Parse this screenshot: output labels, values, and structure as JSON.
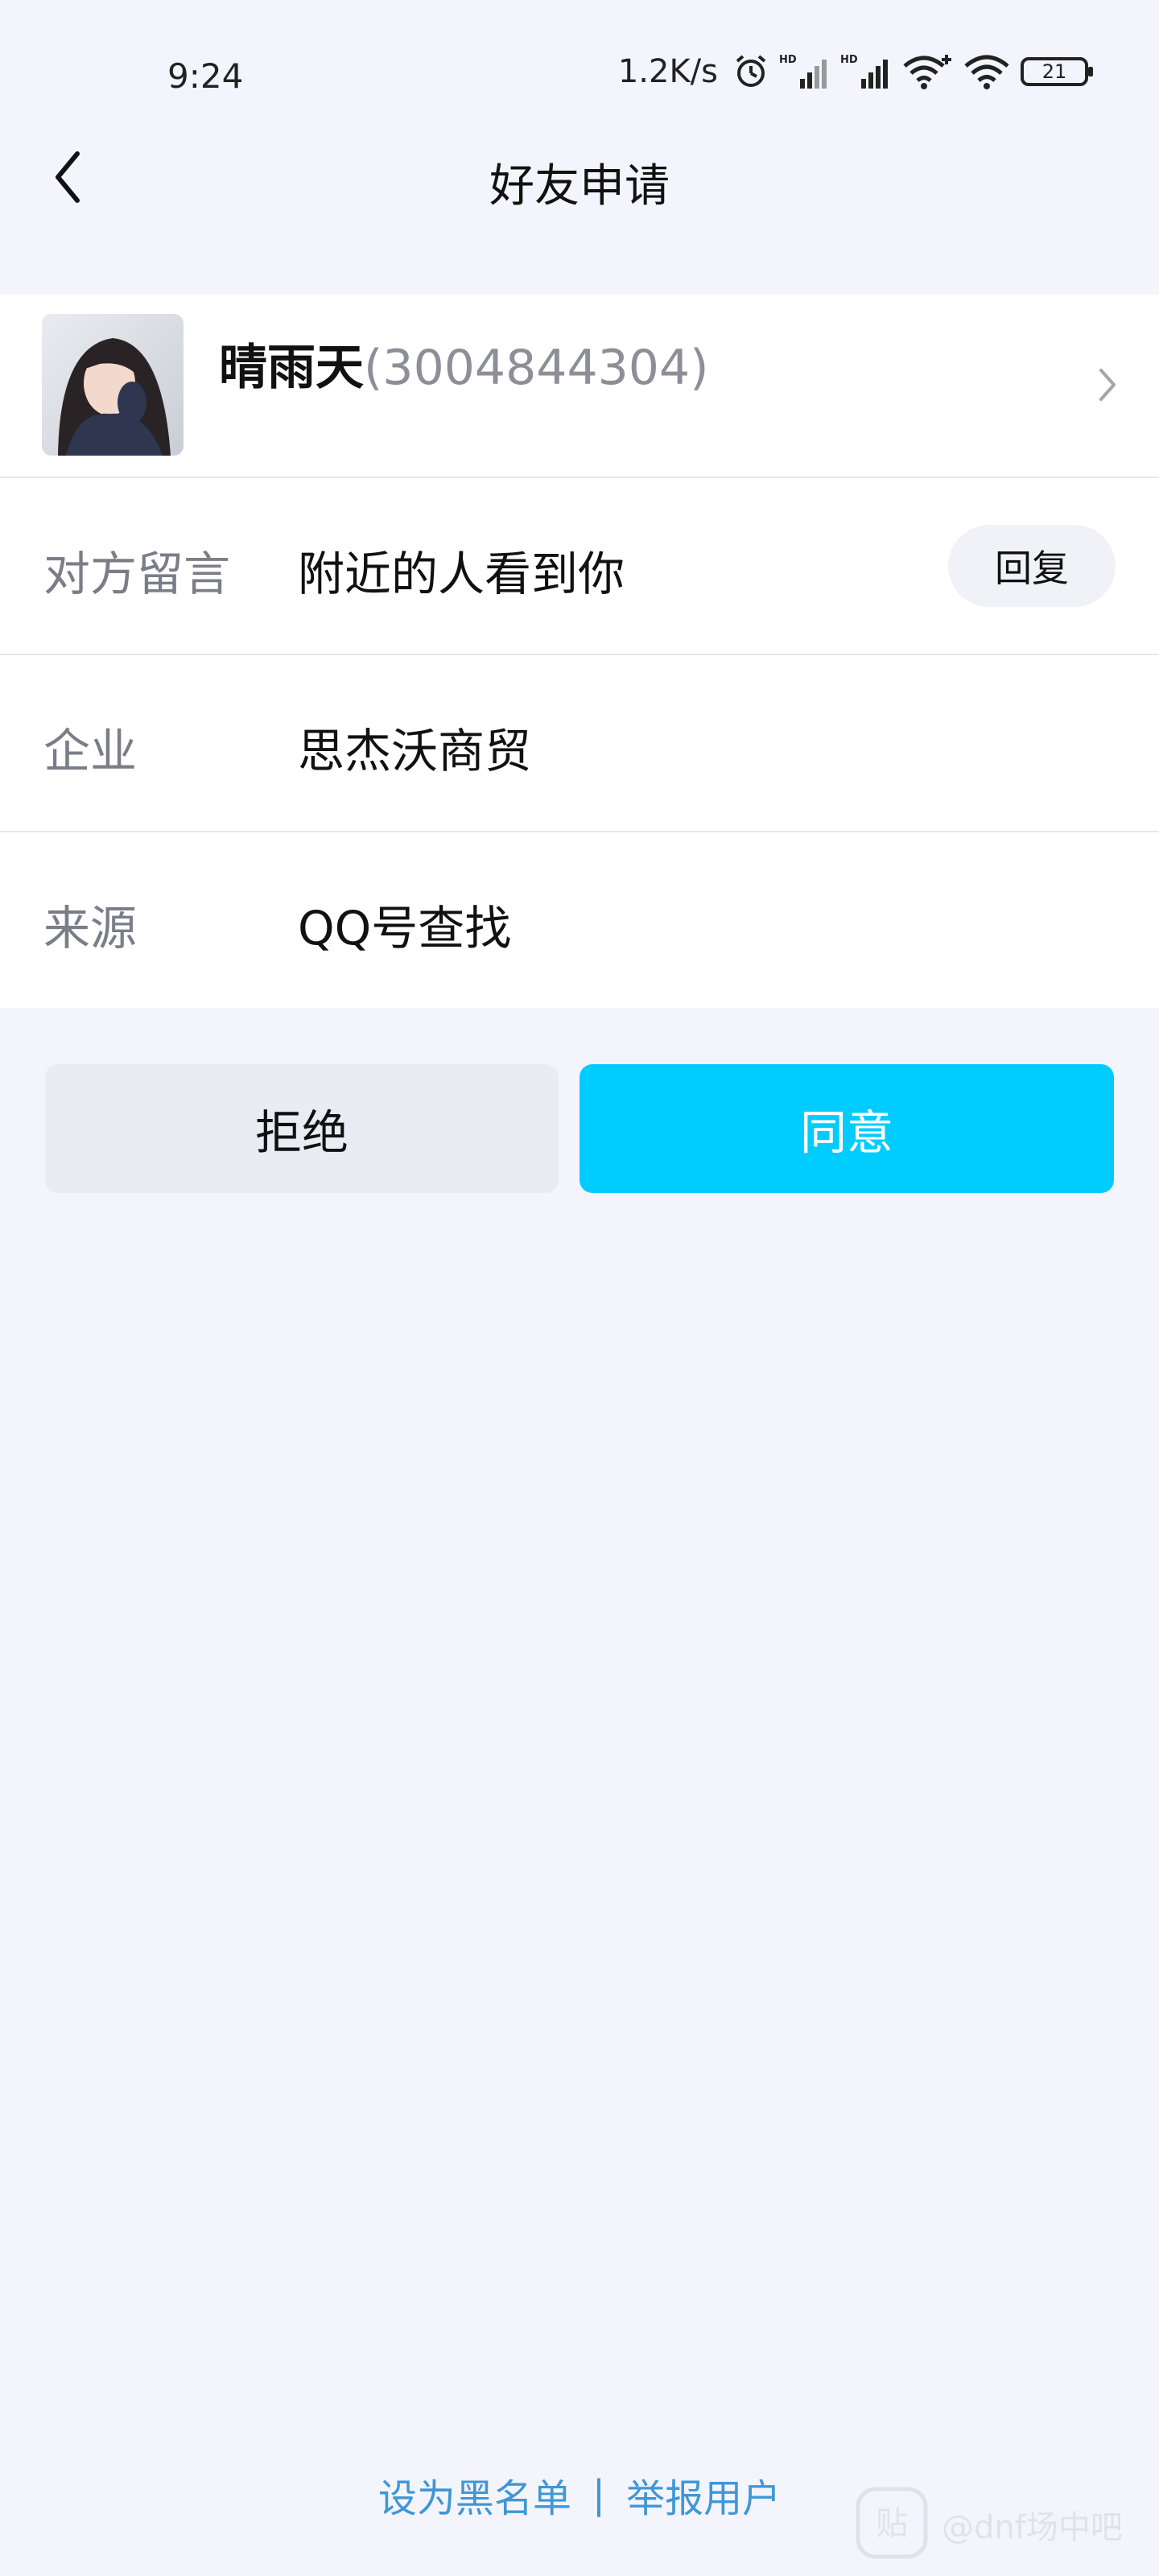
{
  "status_bar": {
    "time": "9:24",
    "network_speed": "1.2K/s",
    "battery": "21",
    "icons": [
      "alarm-icon",
      "signal-hd-icon",
      "signal-hd-icon",
      "wifi-plus-icon",
      "wifi-icon",
      "battery-icon"
    ]
  },
  "header": {
    "title": "好友申请",
    "back_icon": "back-arrow-icon"
  },
  "profile": {
    "name": "晴雨天",
    "id": "(3004844304)",
    "chevron_icon": "chevron-right-icon"
  },
  "info_rows": [
    {
      "label": "对方留言",
      "value": "附近的人看到你",
      "action": "回复"
    },
    {
      "label": "企业",
      "value": "思杰沃商贸"
    },
    {
      "label": "来源",
      "value": "QQ号查找"
    }
  ],
  "actions": {
    "reject": "拒绝",
    "accept": "同意"
  },
  "footer": {
    "blacklist": "设为黑名单",
    "divider": "|",
    "report": "举报用户"
  },
  "watermark": {
    "text": "@dnf场中吧"
  },
  "colors": {
    "background": "#f4f5fc",
    "accept": "#00ccff",
    "link": "#3f97d6"
  }
}
